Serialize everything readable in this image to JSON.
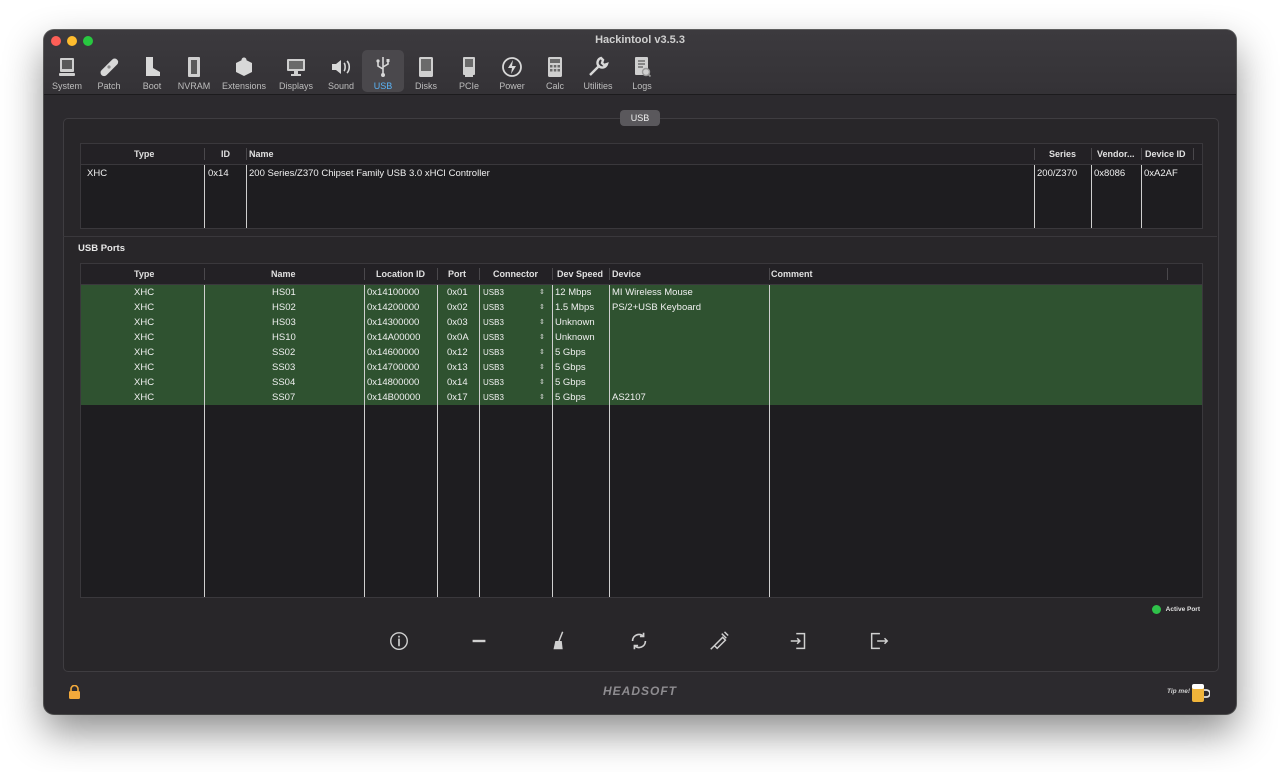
{
  "window": {
    "title": "Hackintool v3.5.3"
  },
  "toolbar": {
    "selected": "USB",
    "items": [
      {
        "label": "System",
        "icon": "system-icon"
      },
      {
        "label": "Patch",
        "icon": "patch-icon"
      },
      {
        "label": "Boot",
        "icon": "boot-icon"
      },
      {
        "label": "NVRAM",
        "icon": "nvram-icon"
      },
      {
        "label": "Extensions",
        "icon": "extensions-icon"
      },
      {
        "label": "Displays",
        "icon": "displays-icon"
      },
      {
        "label": "Sound",
        "icon": "sound-icon"
      },
      {
        "label": "USB",
        "icon": "usb-icon"
      },
      {
        "label": "Disks",
        "icon": "disks-icon"
      },
      {
        "label": "PCIe",
        "icon": "pcie-icon"
      },
      {
        "label": "Power",
        "icon": "power-icon"
      },
      {
        "label": "Calc",
        "icon": "calc-icon"
      },
      {
        "label": "Utilities",
        "icon": "utilities-icon"
      },
      {
        "label": "Logs",
        "icon": "logs-icon"
      }
    ]
  },
  "usb_group": {
    "title": "USB"
  },
  "controllers": {
    "headers": {
      "type": "Type",
      "id": "ID",
      "name": "Name",
      "series": "Series",
      "vendor": "Vendor...",
      "device_id": "Device ID"
    },
    "rows": [
      {
        "type": "XHC",
        "id": "0x14",
        "name": "200 Series/Z370 Chipset Family USB 3.0 xHCI Controller",
        "series": "200/Z370",
        "vendor": "0x8086",
        "device_id": "0xA2AF"
      }
    ]
  },
  "ports": {
    "section_title": "USB Ports",
    "headers": {
      "type": "Type",
      "name": "Name",
      "location_id": "Location ID",
      "port": "Port",
      "connector": "Connector",
      "dev_speed": "Dev Speed",
      "device": "Device",
      "comment": "Comment"
    },
    "rows": [
      {
        "type": "XHC",
        "name": "HS01",
        "location_id": "0x14100000",
        "port": "0x01",
        "connector": "USB3",
        "dev_speed": "12 Mbps",
        "device": "MI Wireless Mouse",
        "comment": ""
      },
      {
        "type": "XHC",
        "name": "HS02",
        "location_id": "0x14200000",
        "port": "0x02",
        "connector": "USB3",
        "dev_speed": "1.5 Mbps",
        "device": "PS/2+USB Keyboard",
        "comment": ""
      },
      {
        "type": "XHC",
        "name": "HS03",
        "location_id": "0x14300000",
        "port": "0x03",
        "connector": "USB3",
        "dev_speed": "Unknown",
        "device": "",
        "comment": ""
      },
      {
        "type": "XHC",
        "name": "HS10",
        "location_id": "0x14A00000",
        "port": "0x0A",
        "connector": "USB3",
        "dev_speed": "Unknown",
        "device": "",
        "comment": ""
      },
      {
        "type": "XHC",
        "name": "SS02",
        "location_id": "0x14600000",
        "port": "0x12",
        "connector": "USB3",
        "dev_speed": "5 Gbps",
        "device": "",
        "comment": ""
      },
      {
        "type": "XHC",
        "name": "SS03",
        "location_id": "0x14700000",
        "port": "0x13",
        "connector": "USB3",
        "dev_speed": "5 Gbps",
        "device": "",
        "comment": ""
      },
      {
        "type": "XHC",
        "name": "SS04",
        "location_id": "0x14800000",
        "port": "0x14",
        "connector": "USB3",
        "dev_speed": "5 Gbps",
        "device": "",
        "comment": ""
      },
      {
        "type": "XHC",
        "name": "SS07",
        "location_id": "0x14B00000",
        "port": "0x17",
        "connector": "USB3",
        "dev_speed": "5 Gbps",
        "device": "AS2107",
        "comment": ""
      }
    ],
    "row_color": "#2f5230"
  },
  "legend": {
    "label": "Active Port",
    "color": "#2fc24a"
  },
  "actions": [
    "info-icon",
    "remove-icon",
    "clear-icon",
    "refresh-icon",
    "inject-icon",
    "import-icon",
    "export-icon"
  ],
  "footer": {
    "brand": "HEADSOFT",
    "tip_label": "Tip me!",
    "lock_color": "#f2a93b"
  }
}
